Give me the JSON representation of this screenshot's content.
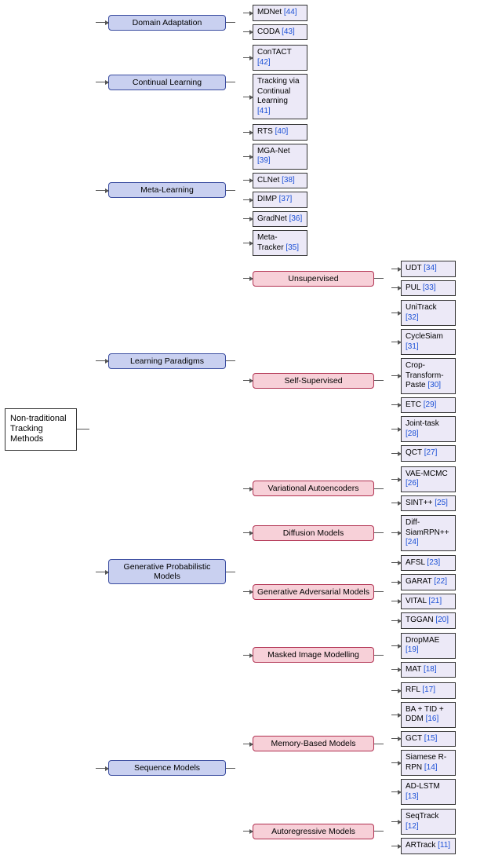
{
  "root": "Non-traditional Tracking Methods",
  "categories": [
    {
      "label": "Domain Adaptation",
      "leaves": [
        {
          "name": "MDNet",
          "ref": "[44]"
        },
        {
          "name": "CODA",
          "ref": "[43]"
        }
      ]
    },
    {
      "label": "Continual Learning",
      "leaves": [
        {
          "name": "ConTACT",
          "ref": "[42]"
        },
        {
          "name": "Tracking via Continual Learning",
          "ref": "[41]"
        }
      ]
    },
    {
      "label": "Meta-Learning",
      "leaves": [
        {
          "name": "RTS",
          "ref": "[40]"
        },
        {
          "name": "MGA-Net",
          "ref": "[39]"
        },
        {
          "name": "CLNet",
          "ref": "[38]"
        },
        {
          "name": "DIMP",
          "ref": "[37]"
        },
        {
          "name": "GradNet",
          "ref": "[36]"
        },
        {
          "name": "Meta-Tracker",
          "ref": "[35]"
        }
      ]
    },
    {
      "label": "Learning Paradigms",
      "subs": [
        {
          "label": "Unsupervised",
          "leaves": [
            {
              "name": "UDT",
              "ref": "[34]"
            },
            {
              "name": "PUL",
              "ref": "[33]"
            }
          ]
        },
        {
          "label": "Self-Supervised",
          "leaves": [
            {
              "name": "UniTrack",
              "ref": "[32]"
            },
            {
              "name": "CycleSiam",
              "ref": "[31]"
            },
            {
              "name": "Crop-Transform-Paste",
              "ref": "[30]"
            },
            {
              "name": "ETC",
              "ref": "[29]"
            },
            {
              "name": "Joint-task",
              "ref": "[28]"
            },
            {
              "name": "QCT",
              "ref": "[27]"
            }
          ]
        }
      ]
    },
    {
      "label": "Generative Probabilistic Models",
      "subs": [
        {
          "label": "Variational Autoencoders",
          "leaves": [
            {
              "name": "VAE-MCMC",
              "ref": "[26]"
            },
            {
              "name": "SINT++",
              "ref": "[25]"
            }
          ]
        },
        {
          "label": "Diffusion Models",
          "leaves": [
            {
              "name": "Diff-SiamRPN++",
              "ref": "[24]"
            }
          ]
        },
        {
          "label": "Generative Adversarial Models",
          "leaves": [
            {
              "name": "AFSL",
              "ref": "[23]"
            },
            {
              "name": "GARAT",
              "ref": "[22]"
            },
            {
              "name": "VITAL",
              "ref": "[21]"
            },
            {
              "name": "TGGAN",
              "ref": "[20]"
            }
          ]
        },
        {
          "label": "Masked Image Modelling",
          "leaves": [
            {
              "name": "DropMAE",
              "ref": "[19]"
            },
            {
              "name": "MAT",
              "ref": "[18]"
            }
          ]
        }
      ]
    },
    {
      "label": "Sequence Models",
      "subs": [
        {
          "label": "Memory-Based Models",
          "leaves": [
            {
              "name": "RFL",
              "ref": "[17]"
            },
            {
              "name": "BA + TID + DDM",
              "ref": "[16]"
            },
            {
              "name": "GCT",
              "ref": "[15]"
            },
            {
              "name": "Siamese R-RPN",
              "ref": "[14]"
            },
            {
              "name": "AD-LSTM",
              "ref": "[13]"
            }
          ]
        },
        {
          "label": "Autoregressive Models",
          "leaves": [
            {
              "name": "SeqTrack",
              "ref": "[12]"
            },
            {
              "name": "ARTrack",
              "ref": "[11]"
            }
          ]
        }
      ]
    }
  ]
}
